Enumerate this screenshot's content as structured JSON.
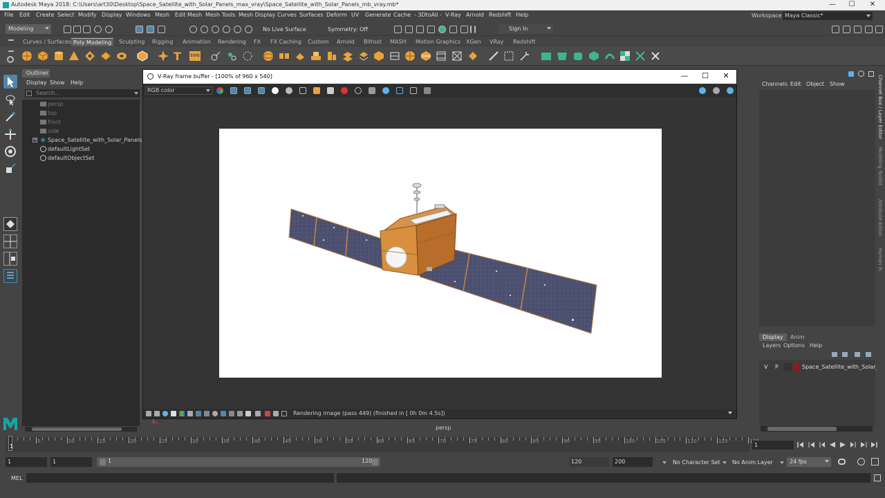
{
  "window": {
    "title": "Autodesk Maya 2018: C:\\Users\\art30\\Desktop\\Space_Satellite_with_Solar_Panels_max_vray\\Space_Satellite_with_Solar_Panels_mb_vray.mb*",
    "minimize": "—",
    "maximize": "☐",
    "close": "✕"
  },
  "menubar": {
    "items": [
      "File",
      "Edit",
      "Create",
      "Select",
      "Modify",
      "Display",
      "Windows",
      "Mesh",
      "Edit Mesh",
      "Mesh Tools",
      "Mesh Display",
      "Curves",
      "Surfaces",
      "Deform",
      "UV",
      "Generate",
      "Cache",
      "- 3DtoAll -",
      "V-Ray",
      "Arnold",
      "Redshift",
      "Help"
    ],
    "workspace_label": "Workspace :",
    "workspace_value": "Maya Classic*"
  },
  "statusline": {
    "mode": "Modeling",
    "live_surface": "No Live Surface",
    "symmetry": "Symmetry: Off",
    "sign_in": "Sign In"
  },
  "shelf": {
    "tabs": [
      "Curves / Surfaces",
      "Poly Modeling",
      "Sculpting",
      "Rigging",
      "Animation",
      "Rendering",
      "FX",
      "FX Caching",
      "Custom",
      "Arnold",
      "Bifrost",
      "MASH",
      "Motion Graphics",
      "XGen",
      "VRay",
      "Redshift"
    ],
    "active_tab": "Poly Modeling",
    "text_icon": "T",
    "svg_icon": "SVG"
  },
  "outliner": {
    "title": "Outliner",
    "menu": [
      "Display",
      "Show",
      "Help"
    ],
    "search_placeholder": "Search...",
    "items": [
      {
        "label": "persp",
        "type": "camera",
        "dim": true
      },
      {
        "label": "top",
        "type": "camera",
        "dim": true
      },
      {
        "label": "front",
        "type": "camera",
        "dim": true
      },
      {
        "label": "side",
        "type": "camera",
        "dim": true
      },
      {
        "label": "Space_Satellite_with_Solar_Panels_nc",
        "type": "group",
        "dim": false
      },
      {
        "label": "defaultLightSet",
        "type": "set",
        "dim": false
      },
      {
        "label": "defaultObjectSet",
        "type": "set",
        "dim": false
      }
    ]
  },
  "vfb": {
    "title": "V-Ray frame buffer - [100% of 960 x 540]",
    "channel": "RGB color",
    "status": "Rendering image (pass 449) (finished in [ 0h  0m  4.5s])"
  },
  "viewport": {
    "camera": "persp"
  },
  "channelbox": {
    "menu": [
      "Channels",
      "Edit",
      "Object",
      "Show"
    ],
    "layer_tabs": [
      "Display",
      "Anim"
    ],
    "layer_menu": [
      "Layers",
      "Options",
      "Help"
    ],
    "layer_row": {
      "v": "V",
      "p": "P",
      "name": "Space_Satellite_with_Solar_Par",
      "color": "#8b1a2a"
    }
  },
  "side_tabs": [
    "Channel Box / Layer Editor",
    "Modeling Toolkit",
    "Attribute Editor",
    "Human IK"
  ],
  "timeline": {
    "ticks": [
      "1",
      "5",
      "10",
      "15",
      "20",
      "25",
      "30",
      "35",
      "40",
      "45",
      "50",
      "55",
      "60",
      "65",
      "70",
      "75",
      "80",
      "85",
      "90",
      "95",
      "100",
      "105",
      "110",
      "115",
      "120"
    ],
    "current_frame": "1",
    "frame_field": "1"
  },
  "range": {
    "start": "1",
    "playback_start": "1",
    "bar_start": "1",
    "bar_end": "120",
    "playback_end": "120",
    "end": "200",
    "character_set": "No Character Set",
    "anim_layer": "No Anim Layer",
    "fps": "24 fps"
  },
  "command": {
    "label": "MEL"
  },
  "colors": {
    "accent": "#5285a6",
    "maya_logo": "#1aa3a3",
    "shelf_orange": "#e8a33c",
    "shelf_green": "#3fb58f"
  }
}
